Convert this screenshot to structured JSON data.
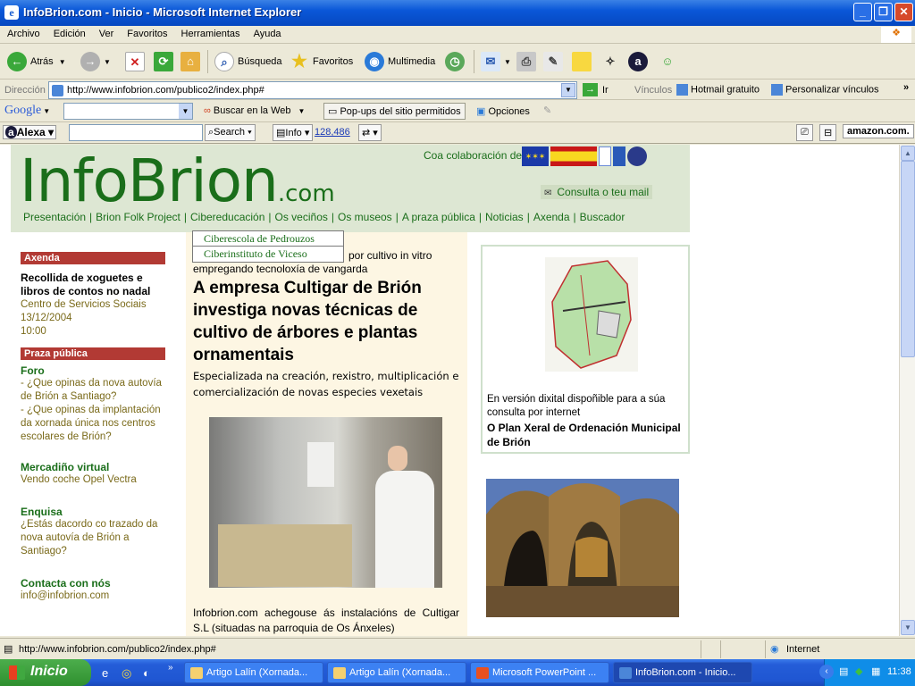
{
  "window": {
    "title": "InfoBrion.com - Inicio - Microsoft Internet Explorer"
  },
  "menu": [
    "Archivo",
    "Edición",
    "Ver",
    "Favoritos",
    "Herramientas",
    "Ayuda"
  ],
  "toolbar": {
    "back": "Atrás",
    "search": "Búsqueda",
    "favorites": "Favoritos",
    "media": "Multimedia"
  },
  "address": {
    "label": "Dirección",
    "url": "http://www.infobrion.com/publico2/index.php#",
    "go": "Ir",
    "links_label": "Vínculos",
    "link1": "Hotmail gratuito",
    "link2": "Personalizar vínculos"
  },
  "google": {
    "brand": "Google",
    "search_web": "Buscar en la Web",
    "popups": "Pop-ups del sitio permitidos",
    "options": "Opciones"
  },
  "alexa": {
    "brand": "Alexa",
    "search": "Search",
    "info": "Info",
    "rank": "128,486",
    "amazon": "amazon.com."
  },
  "site": {
    "logo": "InfoBrion",
    "logo_suffix": ".com",
    "collab": "Coa colaboración de",
    "consulta": "Consulta o teu mail",
    "nav": [
      "Presentación",
      "Brion Folk Project",
      "Cibereducación",
      "Os veciños",
      "Os museos",
      "A praza pública",
      "Noticias",
      "Axenda",
      "Buscador"
    ],
    "dropdown": [
      "Ciberescola de Pedrouzos",
      "Ciberinstituto de Viceso"
    ]
  },
  "left": {
    "axenda_head": "Axenda",
    "event_title": "Recollida de xoguetes e libros de contos no nadal",
    "event_place": "Centro de Servicios Sociais",
    "event_date": "13/12/2004",
    "event_time": "10:00",
    "praza_head": "Praza pública",
    "foro": "Foro",
    "foro_q1": "- ¿Que opinas da nova autovía de Brión a Santiago?",
    "foro_q2": "- ¿Que opinas da implantación da xornada única nos centros escolares de Brión?",
    "mercado": "Mercadiño virtual",
    "mercado_text": "Vendo coche Opel Vectra",
    "enquisa": "Enquisa",
    "enquisa_text": "¿Estás dacordo co trazado da nova autovía de Brión a Santiago?",
    "contact": "Contacta con nós",
    "contact_email": "info@infobrion.com"
  },
  "center": {
    "kicker_part1": "por cultivo in vitro",
    "kicker_part2": "empregando tecnoloxía de vangarda",
    "headline": "A empresa Cultigar de Brión investiga novas técnicas de cultivo de árbores e plantas ornamentais",
    "subhead": "Especializada na creación, rexistro, multiplicación e comercialización de novas especies vexetais",
    "body": "Infobrion.com achegouse ás instalacións de Cultigar S.L (situadas na parroquia de Os Ánxeles)"
  },
  "right": {
    "map_caption": "En versión dixital dispoñible para a súa consulta por internet",
    "map_title": "O Plan Xeral de Ordenación Municipal de Brión"
  },
  "status": {
    "url": "http://www.infobrion.com/publico2/index.php#",
    "zone": "Internet"
  },
  "taskbar": {
    "start": "Inicio",
    "tasks": [
      "Artigo Lalín (Xornada...",
      "Artigo Lalín (Xornada...",
      "Microsoft PowerPoint ...",
      "InfoBrion.com - Inicio..."
    ],
    "clock": "11:38"
  }
}
